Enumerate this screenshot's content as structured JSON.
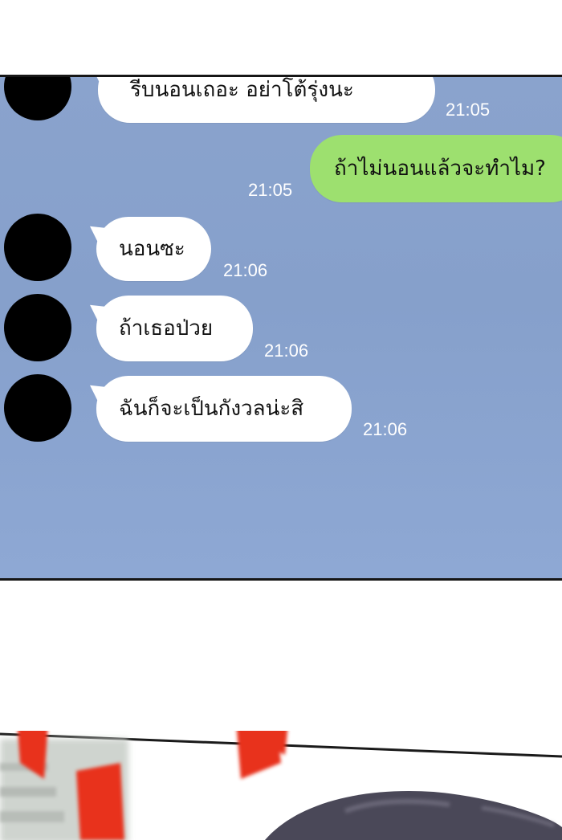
{
  "messages": [
    {
      "side": "in",
      "text": "รีบนอนเถอะ อย่าโต้รุ่งนะ",
      "time": "21:05"
    },
    {
      "side": "out",
      "text": "ถ้าไม่นอนแล้วจะทำไม?",
      "time": "21:05"
    },
    {
      "side": "in",
      "text": "นอนซะ",
      "time": "21:06"
    },
    {
      "side": "in",
      "text": "ถ้าเธอป่วย",
      "time": "21:06"
    },
    {
      "side": "in",
      "text": "ฉันก็จะเป็นกังวลน่ะสิ",
      "time": "21:06"
    }
  ],
  "colors": {
    "chat_bg": "#88a2cc",
    "incoming_bubble": "#ffffff",
    "outgoing_bubble": "#9de06f",
    "time_text": "#ffffff",
    "avatar": "#000000",
    "speed_marks": "#e8301e"
  }
}
